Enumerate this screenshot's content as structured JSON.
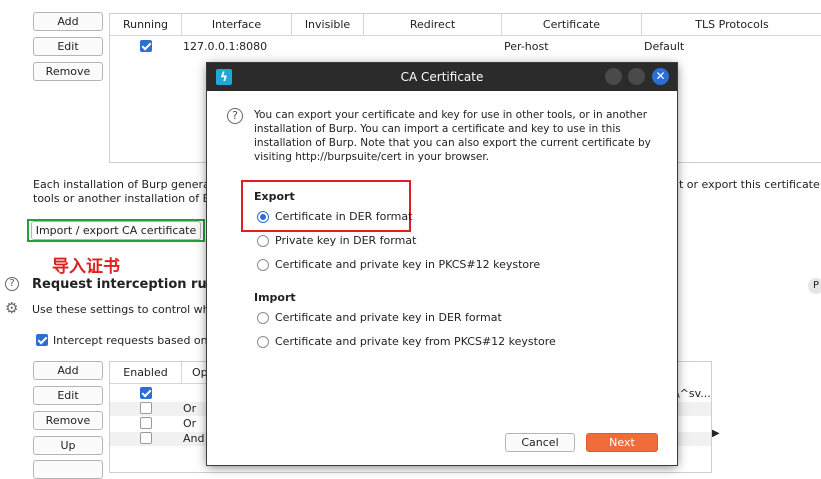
{
  "proxy_buttons": {
    "add": "Add",
    "edit": "Edit",
    "remove": "Remove"
  },
  "listeners_table": {
    "headers": [
      "Running",
      "Interface",
      "Invisible",
      "Redirect",
      "Certificate",
      "TLS Protocols"
    ],
    "rows": [
      {
        "running": true,
        "interface": "127.0.0.1:8080",
        "invisible": "",
        "redirect": "",
        "certificate": "Per-host",
        "tls": "Default"
      }
    ]
  },
  "ca_text_left": [
    "Each installation of Burp generates i",
    "tools or another installation of Burp."
  ],
  "ca_text_right": "t or export this certificate for u",
  "import_export_button": "Import / export CA certificate",
  "annotation_text": "导入证书",
  "interception": {
    "title": "Request interception rules",
    "description": "Use these settings to control which r",
    "checkbox_label": "Intercept requests based on the",
    "buttons": {
      "add": "Add",
      "edit": "Edit",
      "remove": "Remove",
      "up": "Up"
    },
    "table_headers": [
      "Enabled",
      "Op"
    ],
    "rows": [
      {
        "enabled": true,
        "op": ""
      },
      {
        "enabled": false,
        "op": "Or"
      },
      {
        "enabled": false,
        "op": "Or"
      },
      {
        "enabled": false,
        "op": "And"
      }
    ],
    "right_fragment": "\\^sv...",
    "right_badge": "P"
  },
  "dialog": {
    "title": "CA Certificate",
    "info": "You can export your certificate and key for use in other tools, or in another installation of Burp. You can import a certificate and key to use in this installation of Burp. Note that you can also export the current certificate by visiting http://burpsuite/cert in your browser.",
    "export_heading": "Export",
    "export_options": [
      "Certificate in DER format",
      "Private key in DER format",
      "Certificate and private key in PKCS#12 keystore"
    ],
    "import_heading": "Import",
    "import_options": [
      "Certificate and private key in DER format",
      "Certificate and private key from PKCS#12 keystore"
    ],
    "cancel": "Cancel",
    "next": "Next",
    "selected_option": 0
  },
  "colors": {
    "accent": "#2a6ed6",
    "next_button": "#f26b3a",
    "annotation_red": "#e02020",
    "annotation_green": "#22a03a",
    "titlebar": "#2b2b2b"
  }
}
